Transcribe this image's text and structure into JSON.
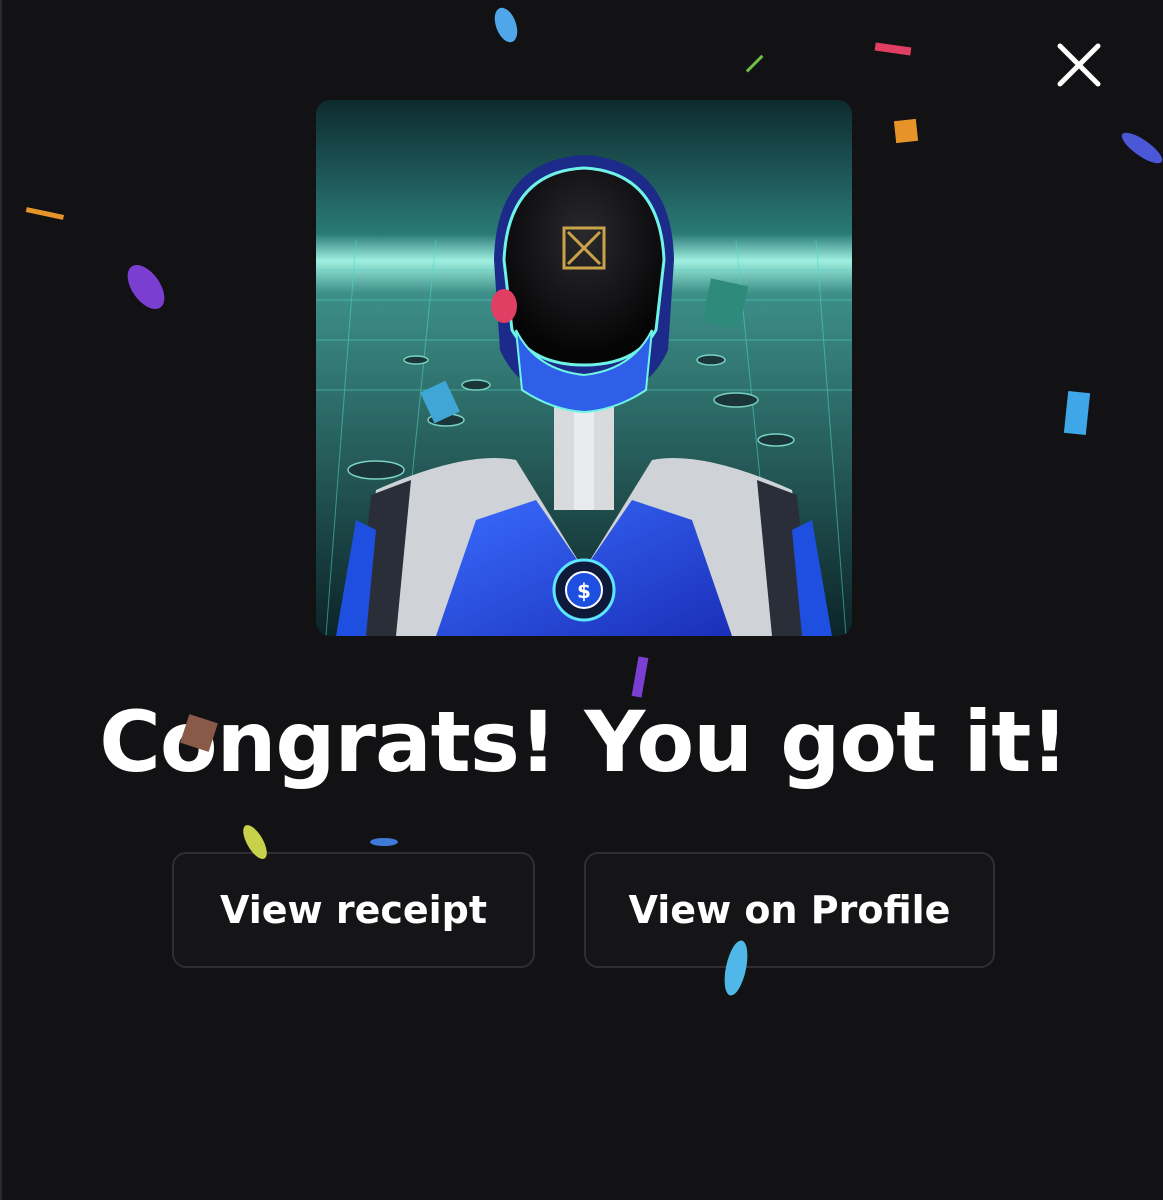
{
  "modal": {
    "close_icon": "close-icon",
    "headline": "Congrats! You got it!",
    "nft_image": "robot-nft-artwork",
    "buttons": {
      "receipt_label": "View receipt",
      "profile_label": "View on Profile"
    }
  },
  "colors": {
    "background": "#121214",
    "button_bg": "#151518",
    "button_border": "#2e2e33",
    "text": "#ffffff"
  }
}
